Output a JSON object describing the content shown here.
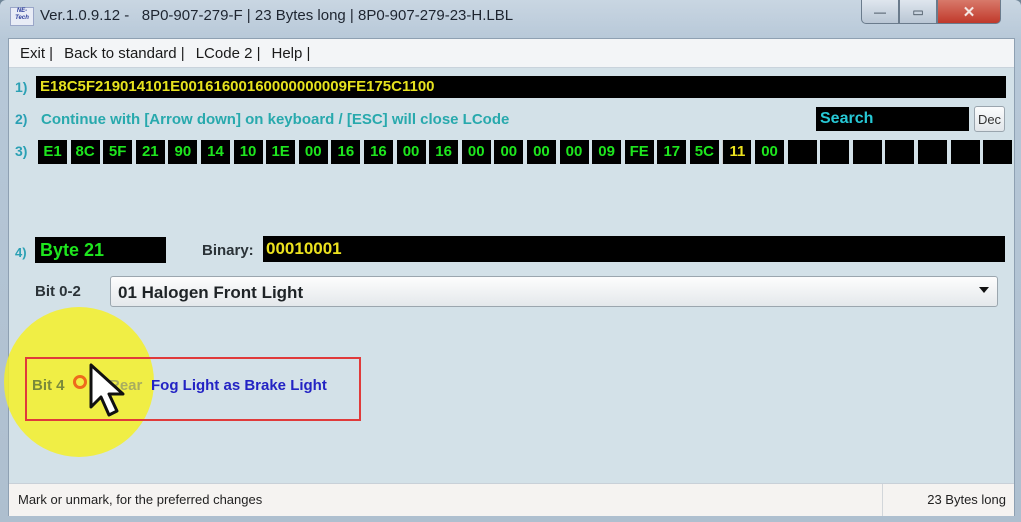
{
  "window": {
    "title": "Ver.1.0.9.12 -   8P0-907-279-F | 23 Bytes long | 8P0-907-279-23-H.LBL",
    "app_icon_text": "NE-Tech",
    "controls": {
      "minimize": "—",
      "maximize": "▭",
      "close": "✕"
    }
  },
  "menu": [
    {
      "label": "Exit |"
    },
    {
      "label": "Back to standard |"
    },
    {
      "label": "LCode 2 |"
    },
    {
      "label": "Help |"
    }
  ],
  "rows": {
    "row1_label": "1)",
    "row2_label": "2)",
    "row3_label": "3)",
    "row4_label": "4)"
  },
  "coding_string": "E18C5F219014101E00161600160000000009FE175C1100",
  "hint_text": "Continue with [Arrow down] on keyboard / [ESC] will close LCode",
  "search": {
    "placeholder": "Search"
  },
  "dec_button": "Dec",
  "bytes": [
    "E1",
    "8C",
    "5F",
    "21",
    "90",
    "14",
    "10",
    "1E",
    "00",
    "16",
    "16",
    "00",
    "16",
    "00",
    "00",
    "00",
    "00",
    "09",
    "FE",
    "17",
    "5C",
    "11",
    "00",
    "",
    "",
    "",
    "",
    "",
    "",
    ""
  ],
  "selected_byte_index": 21,
  "byte_label": "Byte 21",
  "binary_label": "Binary:",
  "binary_value": "00010001",
  "bit02": {
    "label": "Bit 0-2",
    "selected_option": "01 Halogen Front Light"
  },
  "bit4": {
    "label": "Bit 4",
    "checked": false,
    "text_prefix": "Rear",
    "text_suffix": "Fog Light as Brake Light"
  },
  "colors": {
    "hex_text": "#e6e21e",
    "byte_text": "#1ee61e",
    "hint_text": "#28a9ad",
    "annotation_red": "#e03a3a",
    "highlight_yellow": "#f4f028"
  },
  "status": {
    "left": "Mark or unmark, for the preferred changes",
    "right": "23 Bytes long"
  }
}
